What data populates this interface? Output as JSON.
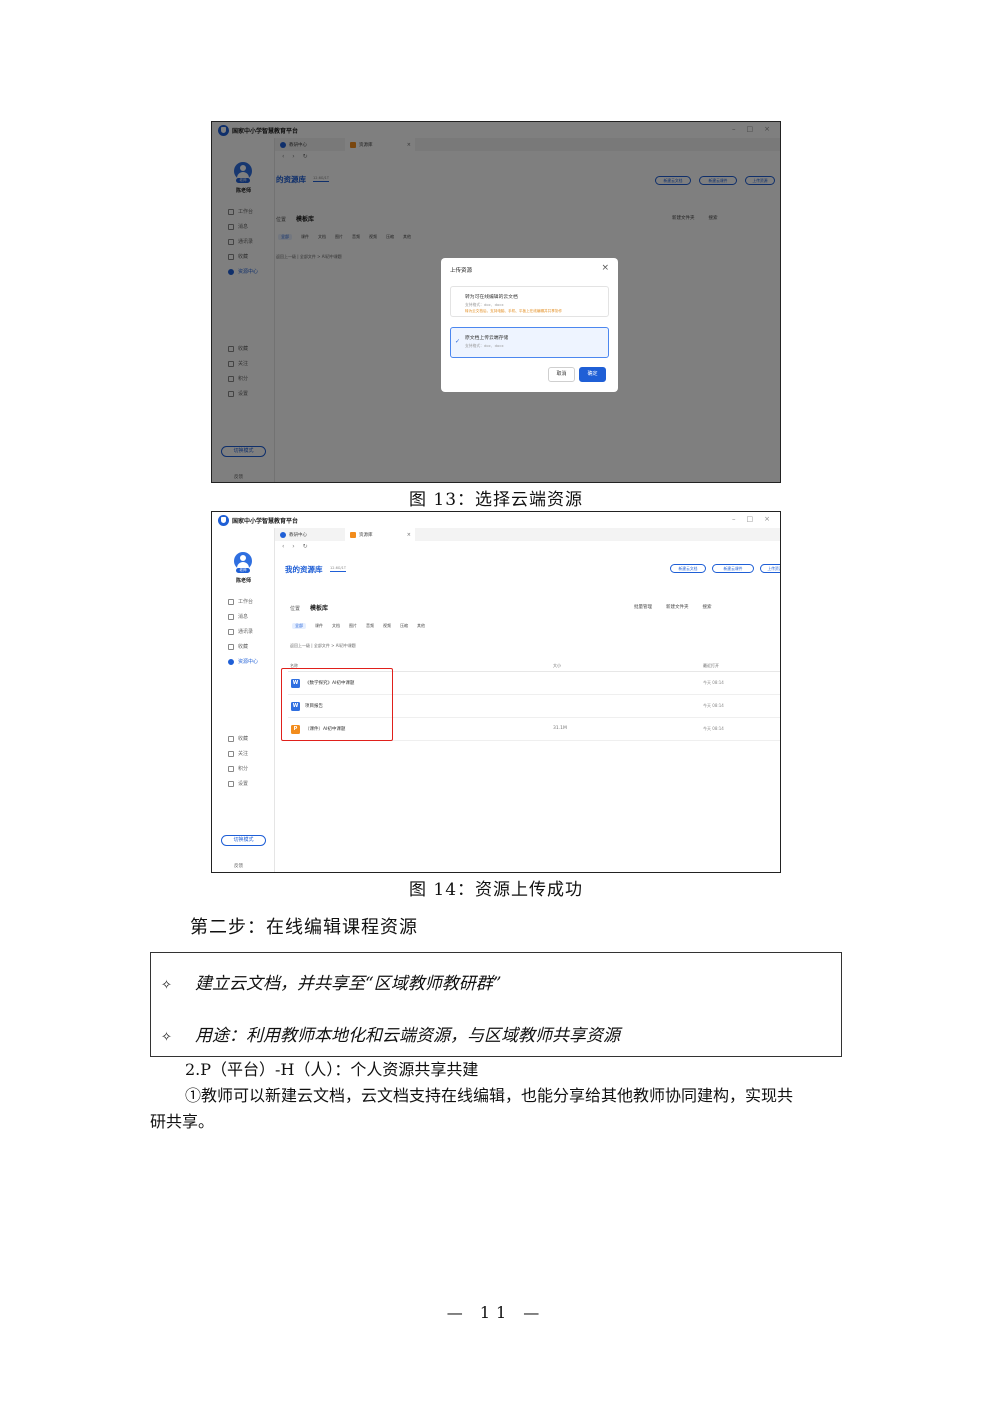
{
  "app": {
    "title": "国家中小学智慧教育平台",
    "user": "陈老师",
    "avatar_badge": "老师",
    "nav": [
      "工作台",
      "消息",
      "通讯录",
      "收藏",
      "资源中心"
    ],
    "nav_bottom": [
      "收藏",
      "关注",
      "积分",
      "设置"
    ],
    "mode_button": "切换模式",
    "feedback": "反馈",
    "tabs": [
      "教研中心",
      "资源库"
    ],
    "library_title": "我的资源库",
    "library_title_cut": "的资源库",
    "library_sub": "12.6G/1T",
    "top_buttons": [
      "新建云文档",
      "新建云课件",
      "上传资源"
    ],
    "location_label": "位置",
    "location_value": "模板库",
    "toolbar_right": [
      "新建文件夹",
      "搜索"
    ],
    "toolbar_right_fig14": [
      "批量管理",
      "新建文件夹",
      "搜索"
    ],
    "filters": [
      "全部",
      "课件",
      "文档",
      "图片",
      "音频",
      "视频",
      "压缩",
      "其他"
    ],
    "path": "返回上一级 | 全部文件 > AI初中课题",
    "accent_color": "#1f5fd6"
  },
  "fig13": {
    "dialog_title": "上传资源",
    "option1_title": "转为可在线编辑的云文档",
    "option1_formats": "支持格式：doc、docx",
    "option1_note": "转为云文档后，支持电脑、手机、平板上在线编辑并共享协作",
    "option2_title": "原文档上传云端存储",
    "option2_formats": "支持格式：doc、docx",
    "cancel": "取消",
    "ok": "确定",
    "caption": "图 13：选择云端资源"
  },
  "fig14": {
    "columns": [
      "名称",
      "大小",
      "最近打开"
    ],
    "rows": [
      {
        "icon": "W",
        "name": "《数学探究》AI初中课题",
        "size": "",
        "time": "今天 08:14"
      },
      {
        "icon": "W",
        "name": "项目报告",
        "size": "",
        "time": "今天 08:14"
      },
      {
        "icon": "P",
        "name": "（课件）AI初中课题",
        "size": "31.1M",
        "time": "今天 08:14"
      }
    ],
    "caption": "图 14：资源上传成功"
  },
  "doc": {
    "step": "第二步：在线编辑课程资源",
    "box_items": [
      "建立云文档，并共享至“区域教师教研群”",
      "用途：利用教师本地化和云端资源，与区域教师共享资源"
    ],
    "bullet": "✧",
    "para_heading": "2.P（平台）-H（人）：个人资源共享共建",
    "para_line1": "①教师可以新建云文档，云文档支持在线编辑，也能分享给其他教师协同建构，实现共",
    "para_line2": "研共享。",
    "page_number": "— 11 —"
  }
}
